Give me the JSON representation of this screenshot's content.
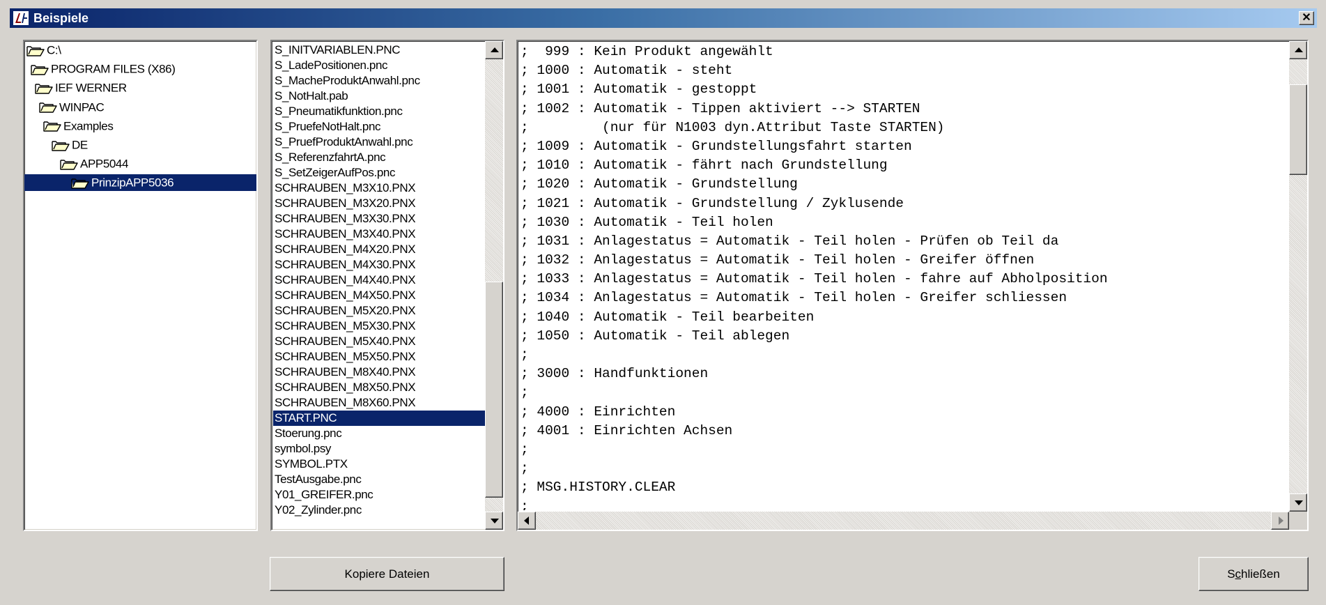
{
  "window": {
    "title": "Beispiele",
    "close_glyph": "✕"
  },
  "folder_tree": {
    "items": [
      {
        "label": "C:\\",
        "icon": "open-folder-icon"
      },
      {
        "label": "PROGRAM FILES (X86)",
        "icon": "open-folder-icon"
      },
      {
        "label": "IEF WERNER",
        "icon": "open-folder-icon"
      },
      {
        "label": "WINPAC",
        "icon": "open-folder-icon"
      },
      {
        "label": "Examples",
        "icon": "open-folder-icon"
      },
      {
        "label": "DE",
        "icon": "open-folder-icon"
      },
      {
        "label": "APP5044",
        "icon": "open-folder-icon"
      },
      {
        "label": "PrinzipAPP5036",
        "icon": "open-folder-icon",
        "selected": true
      }
    ]
  },
  "file_list": {
    "items": [
      "S_INITVARIABLEN.PNC",
      "S_LadePositionen.pnc",
      "S_MacheProduktAnwahl.pnc",
      "S_NotHalt.pab",
      "S_Pneumatikfunktion.pnc",
      "S_PruefeNotHalt.pnc",
      "S_PruefProduktAnwahl.pnc",
      "S_ReferenzfahrtA.pnc",
      "S_SetZeigerAufPos.pnc",
      "SCHRAUBEN_M3X10.PNX",
      "SCHRAUBEN_M3X20.PNX",
      "SCHRAUBEN_M3X30.PNX",
      "SCHRAUBEN_M3X40.PNX",
      "SCHRAUBEN_M4X20.PNX",
      "SCHRAUBEN_M4X30.PNX",
      "SCHRAUBEN_M4X40.PNX",
      "SCHRAUBEN_M4X50.PNX",
      "SCHRAUBEN_M5X20.PNX",
      "SCHRAUBEN_M5X30.PNX",
      "SCHRAUBEN_M5X40.PNX",
      "SCHRAUBEN_M5X50.PNX",
      "SCHRAUBEN_M8X40.PNX",
      "SCHRAUBEN_M8X50.PNX",
      "SCHRAUBEN_M8X60.PNX",
      "START.PNC",
      "Stoerung.pnc",
      "symbol.psy",
      "SYMBOL.PTX",
      "TestAusgabe.pnc",
      "Y01_GREIFER.pnc",
      "Y02_Zylinder.pnc"
    ],
    "selected": "START.PNC"
  },
  "text_view": {
    "lines": [
      ";  999 : Kein Produkt angewählt",
      "; 1000 : Automatik - steht",
      "; 1001 : Automatik - gestoppt",
      "; 1002 : Automatik - Tippen aktiviert --> STARTEN",
      ";         (nur für N1003 dyn.Attribut Taste STARTEN)",
      "; 1009 : Automatik - Grundstellungsfahrt starten",
      "; 1010 : Automatik - fährt nach Grundstellung",
      "; 1020 : Automatik - Grundstellung",
      "; 1021 : Automatik - Grundstellung / Zyklusende",
      "; 1030 : Automatik - Teil holen",
      "; 1031 : Anlagestatus = Automatik - Teil holen - Prüfen ob Teil da",
      "; 1032 : Anlagestatus = Automatik - Teil holen - Greifer öffnen",
      "; 1033 : Anlagestatus = Automatik - Teil holen - fahre auf Abholposition",
      "; 1034 : Anlagestatus = Automatik - Teil holen - Greifer schliessen",
      "; 1040 : Automatik - Teil bearbeiten",
      "; 1050 : Automatik - Teil ablegen",
      ";",
      "; 3000 : Handfunktionen",
      ";",
      "; 4000 : Einrichten",
      "; 4001 : Einrichten Achsen",
      ";",
      ";",
      "; MSG.HISTORY.CLEAR",
      ";"
    ]
  },
  "buttons": {
    "copy_label": "Kopiere Dateien",
    "close_label_pre": "S",
    "close_label_mnemonic": "c",
    "close_label_post": "hließen"
  },
  "colors": {
    "title_gradient_start": "#0a246a",
    "title_gradient_end": "#a6caf0",
    "selection": "#0a246a",
    "face": "#d6d3ce"
  }
}
